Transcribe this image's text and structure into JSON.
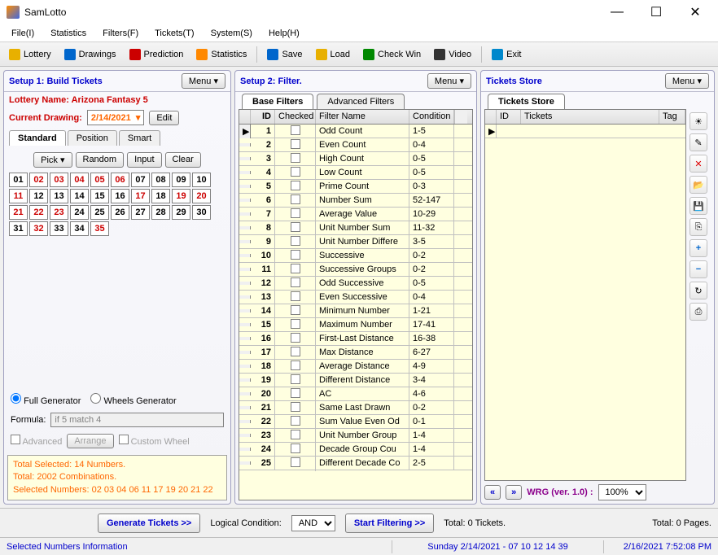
{
  "title": "SamLotto",
  "menubar": [
    "File(I)",
    "Statistics",
    "Filters(F)",
    "Tickets(T)",
    "System(S)",
    "Help(H)"
  ],
  "toolbar": [
    {
      "label": "Lottery"
    },
    {
      "label": "Drawings"
    },
    {
      "label": "Prediction"
    },
    {
      "label": "Statistics"
    },
    {
      "label": "Save"
    },
    {
      "label": "Load"
    },
    {
      "label": "Check Win"
    },
    {
      "label": "Video"
    },
    {
      "label": "Exit"
    }
  ],
  "setup1": {
    "title": "Setup 1: Build  Tickets",
    "menu": "Menu  ▾",
    "lottery": "Lottery  Name:  Arizona Fantasy 5",
    "drawing_lbl": "Current Drawing:",
    "drawing_date": "2/14/2021",
    "edit": "Edit",
    "tabs": [
      "Standard",
      "Position",
      "Smart"
    ],
    "btns": [
      "Pick ▾",
      "Random",
      "Input",
      "Clear"
    ],
    "numbers": [
      [
        "01",
        "02",
        "03",
        "04",
        "05",
        "06",
        "07",
        "08",
        "09",
        "10"
      ],
      [
        "11",
        "12",
        "13",
        "14",
        "15",
        "16",
        "17",
        "18",
        "19",
        "20"
      ],
      [
        "21",
        "22",
        "23",
        "24",
        "25",
        "26",
        "27",
        "28",
        "29",
        "30"
      ],
      [
        "31",
        "32",
        "33",
        "34",
        "35"
      ]
    ],
    "selected_nums": [
      "02",
      "03",
      "04",
      "05",
      "06",
      "11",
      "17",
      "19",
      "20",
      "21",
      "22",
      "23",
      "32",
      "35"
    ],
    "radio1": "Full Generator",
    "radio2": "Wheels Generator",
    "formula_lbl": "Formula:",
    "formula_val": "if 5 match 4",
    "adv": "Advanced",
    "arrange": "Arrange",
    "custom": "Custom Wheel",
    "info1": "Total Selected: 14 Numbers.",
    "info2": "Total: 2002 Combinations.",
    "info3": "Selected Numbers: 02 03 04 06 11 17 19 20 21 22"
  },
  "setup2": {
    "title": "Setup 2: Filter.",
    "tabs": [
      "Base Filters",
      "Advanced Filters"
    ],
    "cols": [
      "ID",
      "Checked",
      "Filter Name",
      "Condition"
    ],
    "rows": [
      {
        "id": "1",
        "name": "Odd Count",
        "cond": "1-5"
      },
      {
        "id": "2",
        "name": "Even Count",
        "cond": "0-4"
      },
      {
        "id": "3",
        "name": "High Count",
        "cond": "0-5"
      },
      {
        "id": "4",
        "name": "Low Count",
        "cond": "0-5"
      },
      {
        "id": "5",
        "name": "Prime Count",
        "cond": "0-3"
      },
      {
        "id": "6",
        "name": "Number Sum",
        "cond": "52-147"
      },
      {
        "id": "7",
        "name": "Average Value",
        "cond": "10-29"
      },
      {
        "id": "8",
        "name": "Unit Number Sum",
        "cond": "11-32"
      },
      {
        "id": "9",
        "name": "Unit Number Differe",
        "cond": "3-5"
      },
      {
        "id": "10",
        "name": "Successive",
        "cond": "0-2"
      },
      {
        "id": "11",
        "name": "Successive Groups",
        "cond": "0-2"
      },
      {
        "id": "12",
        "name": "Odd Successive",
        "cond": "0-5"
      },
      {
        "id": "13",
        "name": "Even Successive",
        "cond": "0-4"
      },
      {
        "id": "14",
        "name": "Minimum Number",
        "cond": "1-21"
      },
      {
        "id": "15",
        "name": "Maximum Number",
        "cond": "17-41"
      },
      {
        "id": "16",
        "name": "First-Last Distance",
        "cond": "16-38"
      },
      {
        "id": "17",
        "name": "Max Distance",
        "cond": "6-27"
      },
      {
        "id": "18",
        "name": "Average Distance",
        "cond": "4-9"
      },
      {
        "id": "19",
        "name": "Different Distance",
        "cond": "3-4"
      },
      {
        "id": "20",
        "name": "AC",
        "cond": "4-6"
      },
      {
        "id": "21",
        "name": "Same Last Drawn",
        "cond": "0-2"
      },
      {
        "id": "22",
        "name": "Sum Value Even Od",
        "cond": "0-1"
      },
      {
        "id": "23",
        "name": "Unit Number Group",
        "cond": "1-4"
      },
      {
        "id": "24",
        "name": "Decade Group Cou",
        "cond": "1-4"
      },
      {
        "id": "25",
        "name": "Different Decade Co",
        "cond": "2-5"
      }
    ]
  },
  "tickets_store": {
    "title": "Tickets Store",
    "tab": "Tickets Store",
    "cols": [
      "ID",
      "Tickets",
      "Tag"
    ],
    "wrg": "WRG (ver. 1.0) :",
    "zoom": "100%"
  },
  "bottom": {
    "generate": "Generate Tickets >>",
    "logical": "Logical Condition:",
    "and": "AND",
    "filter": "Start Filtering >>",
    "total_tickets": "Total: 0 Tickets.",
    "total_pages": "Total: 0 Pages."
  },
  "status": {
    "left": "Selected Numbers Information",
    "mid": "Sunday 2/14/2021 - 07 10 12 14 39",
    "right": "2/16/2021 7:52:08 PM"
  }
}
